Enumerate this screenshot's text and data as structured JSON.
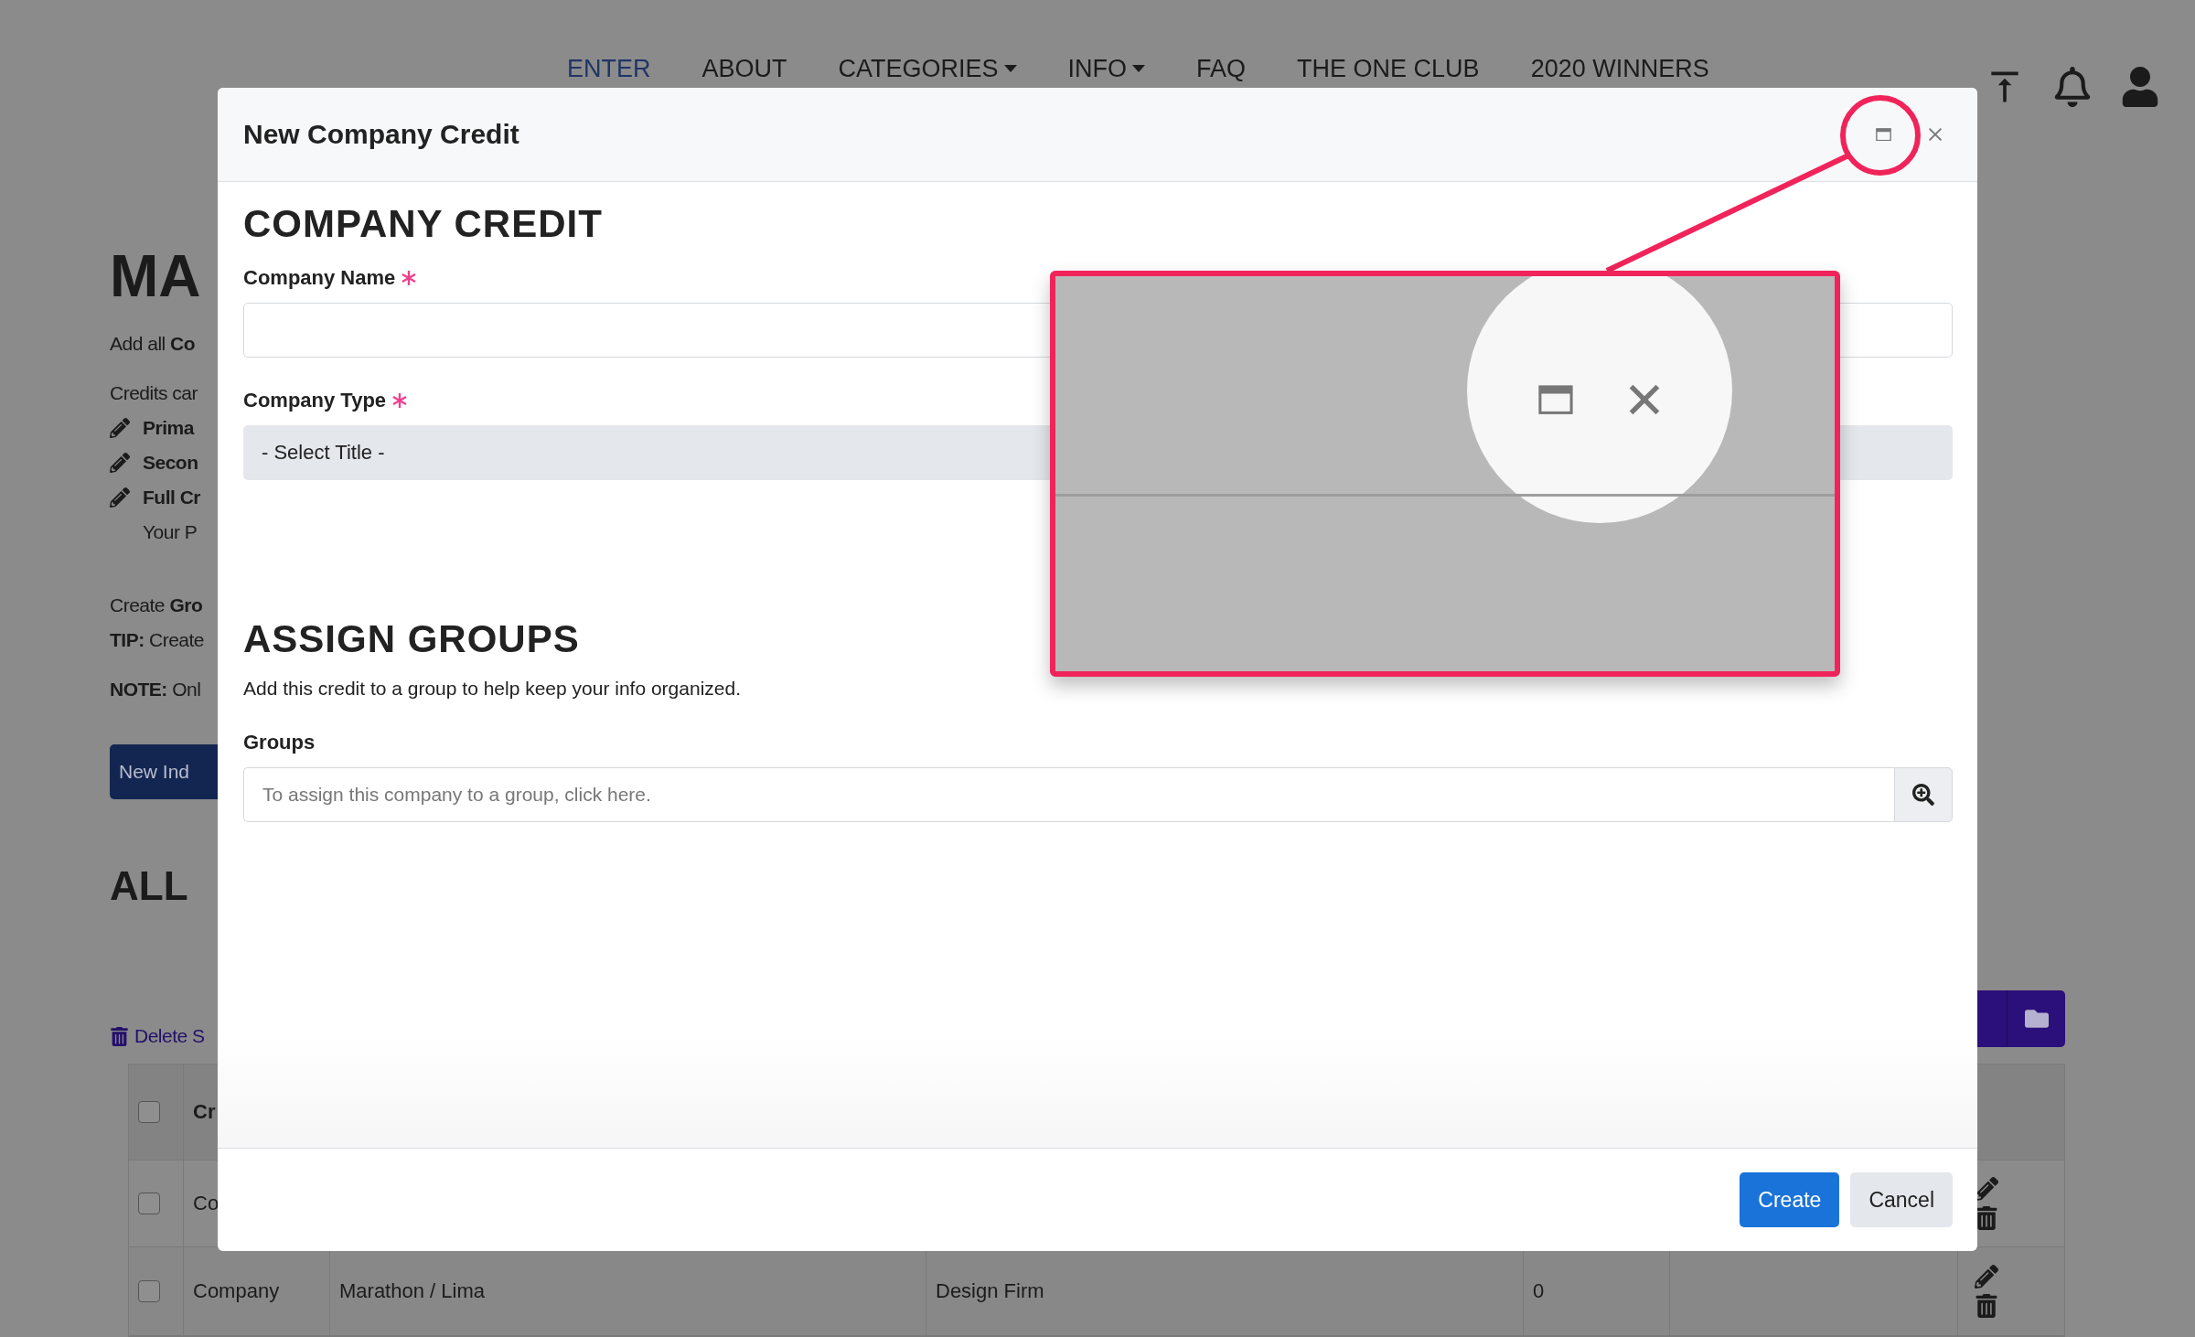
{
  "nav": {
    "links": [
      {
        "label": "ENTER",
        "selected": true
      },
      {
        "label": "ABOUT",
        "selected": false
      },
      {
        "label": "CATEGORIES",
        "selected": false,
        "dropdown": true
      },
      {
        "label": "INFO",
        "selected": false,
        "dropdown": true
      },
      {
        "label": "FAQ",
        "selected": false
      },
      {
        "label": "THE ONE CLUB",
        "selected": false
      },
      {
        "label": "2020 WINNERS",
        "selected": false
      }
    ]
  },
  "page": {
    "title": "MA",
    "intro": "Add all **Co**",
    "credits_intro": "Credits car",
    "bullets": [
      {
        "text": "Prima"
      },
      {
        "text": "Secon"
      },
      {
        "text": "Full Cr",
        "note": "Your P"
      }
    ],
    "groups_line": "Create **Gro**",
    "tip": "**TIP:** Create",
    "note": "**NOTE:** Onl",
    "new_button": "New Ind",
    "section_title": "ALL",
    "delete_link": "Delete S",
    "table": {
      "header": {
        "checked": false,
        "column_1": "Cr"
      },
      "rows": [
        {
          "checked": false,
          "cells": [
            "Co"
          ]
        },
        {
          "checked": false,
          "cells": [
            "Company",
            "Marathon / Lima",
            "Design Firm",
            "0"
          ]
        }
      ]
    }
  },
  "modal": {
    "title": "New Company Credit",
    "section_1": "COMPANY CREDIT",
    "company_name": {
      "label": "Company Name",
      "required": true
    },
    "company_type": {
      "label": "Company Type",
      "required": true,
      "value": "- Select Title -"
    },
    "section_2": "ASSIGN GROUPS",
    "section_2_text": "Add this credit to a group to help keep your info organized.",
    "groups": {
      "label": "Groups",
      "placeholder": "To assign this company to a group, click here."
    },
    "buttons": [
      {
        "label": "Create",
        "kind": "primary"
      },
      {
        "label": "Cancel",
        "kind": "secondary"
      }
    ]
  }
}
